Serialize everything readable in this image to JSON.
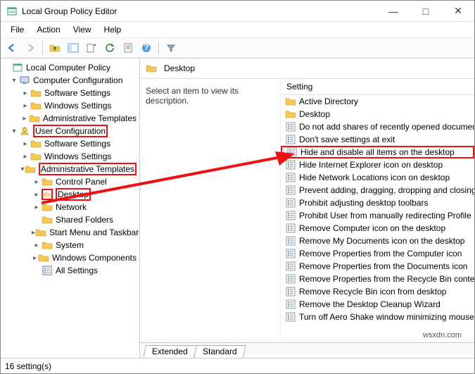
{
  "window": {
    "title": "Local Group Policy Editor"
  },
  "menu": {
    "file": "File",
    "action": "Action",
    "view": "View",
    "help": "Help"
  },
  "tree": {
    "root": "Local Computer Policy",
    "cc": "Computer Configuration",
    "cc_sw": "Software Settings",
    "cc_win": "Windows Settings",
    "cc_adm": "Administrative Templates",
    "uc": "User Configuration",
    "uc_sw": "Software Settings",
    "uc_win": "Windows Settings",
    "uc_adm": "Administrative Templates",
    "cp": "Control Panel",
    "desk": "Desktop",
    "net": "Network",
    "sf": "Shared Folders",
    "smt": "Start Menu and Taskbar",
    "sys": "System",
    "wc": "Windows Components",
    "all": "All Settings"
  },
  "content": {
    "header": "Desktop",
    "hint": "Select an item to view its description.",
    "col": "Setting",
    "items": [
      "Active Directory",
      "Desktop",
      "Do not add shares of recently opened documents",
      "Don't save settings at exit",
      "Hide and disable all items on the desktop",
      "Hide Internet Explorer icon on desktop",
      "Hide Network Locations icon on desktop",
      "Prevent adding, dragging, dropping and closing",
      "Prohibit adjusting desktop toolbars",
      "Prohibit User from manually redirecting Profile",
      "Remove Computer icon on the desktop",
      "Remove My Documents icon on the desktop",
      "Remove Properties from the Computer icon",
      "Remove Properties from the Documents icon",
      "Remove Properties from the Recycle Bin context",
      "Remove Recycle Bin icon from desktop",
      "Remove the Desktop Cleanup Wizard",
      "Turn off Aero Shake window minimizing mouse"
    ],
    "tabs": {
      "ext": "Extended",
      "std": "Standard"
    }
  },
  "status": {
    "text": "16 setting(s)"
  },
  "watermark": "wsxdn.com"
}
